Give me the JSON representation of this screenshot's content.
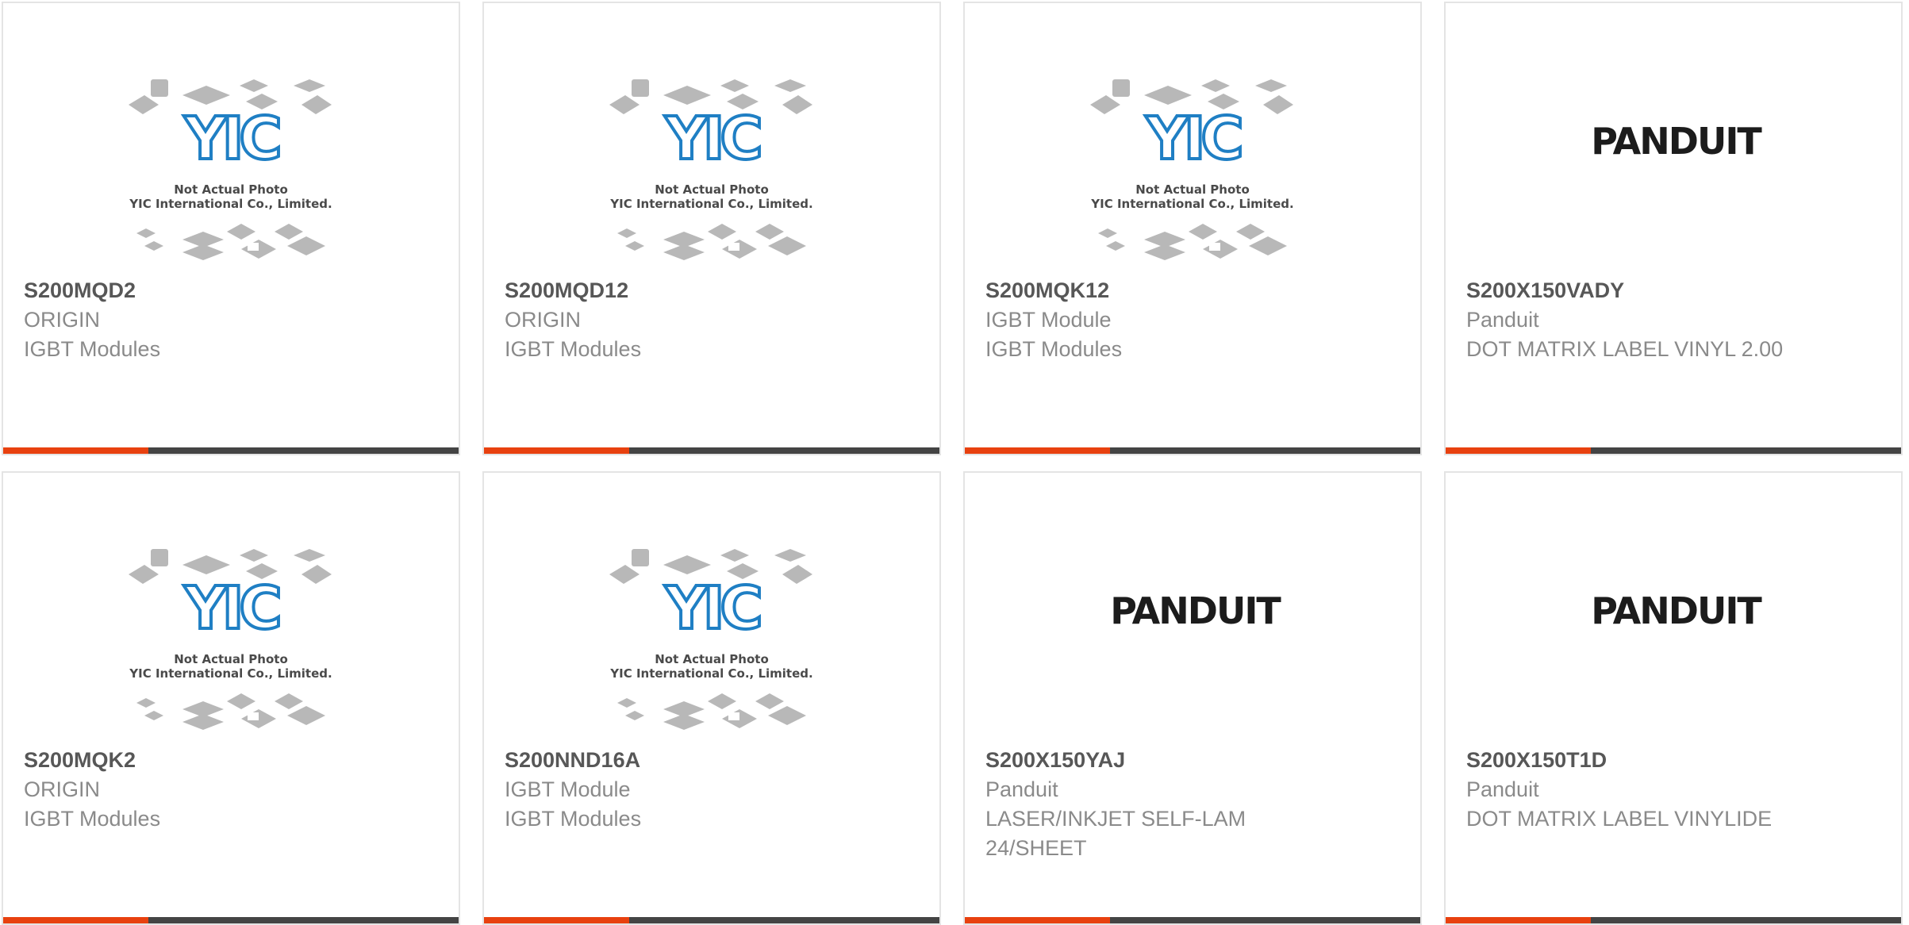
{
  "products": [
    {
      "part": "S200MQD2",
      "manufacturer": "ORIGIN",
      "description": "IGBT Modules",
      "image": "yic",
      "image_caption": [
        "Not Actual Photo",
        "YIC International Co., Limited."
      ]
    },
    {
      "part": "S200MQD12",
      "manufacturer": "ORIGIN",
      "description": "IGBT Modules",
      "image": "yic",
      "image_caption": [
        "Not Actual Photo",
        "YIC International Co., Limited."
      ]
    },
    {
      "part": "S200MQK12",
      "manufacturer": "IGBT Module",
      "description": "IGBT Modules",
      "image": "yic",
      "image_caption": [
        "Not Actual Photo",
        "YIC International Co., Limited."
      ]
    },
    {
      "part": "S200X150VADY",
      "manufacturer": "Panduit",
      "description": "DOT MATRIX LABEL VINYL 2.00",
      "image": "panduit",
      "image_caption": [
        "PANDUIT"
      ]
    },
    {
      "part": "S200MQK2",
      "manufacturer": "ORIGIN",
      "description": "IGBT Modules",
      "image": "yic",
      "image_caption": [
        "Not Actual Photo",
        "YIC International Co., Limited."
      ]
    },
    {
      "part": "S200NND16A",
      "manufacturer": "IGBT Module",
      "description": "IGBT Modules",
      "image": "yic",
      "image_caption": [
        "Not Actual Photo",
        "YIC International Co., Limited."
      ]
    },
    {
      "part": "S200X150YAJ",
      "manufacturer": "Panduit",
      "description": "LASER/INKJET SELF-LAM 24/SHEET",
      "image": "panduit",
      "image_caption": [
        "PANDUIT"
      ]
    },
    {
      "part": "S200X150T1D",
      "manufacturer": "Panduit",
      "description": "DOT MATRIX LABEL VINYLIDE",
      "image": "panduit",
      "image_caption": [
        "PANDUIT"
      ]
    }
  ],
  "colors": {
    "accent": "#e8410f",
    "bar": "#444444",
    "part_text": "#575757",
    "meta_text": "#8a8a8a",
    "yic_blue": "#1f7fc4"
  }
}
